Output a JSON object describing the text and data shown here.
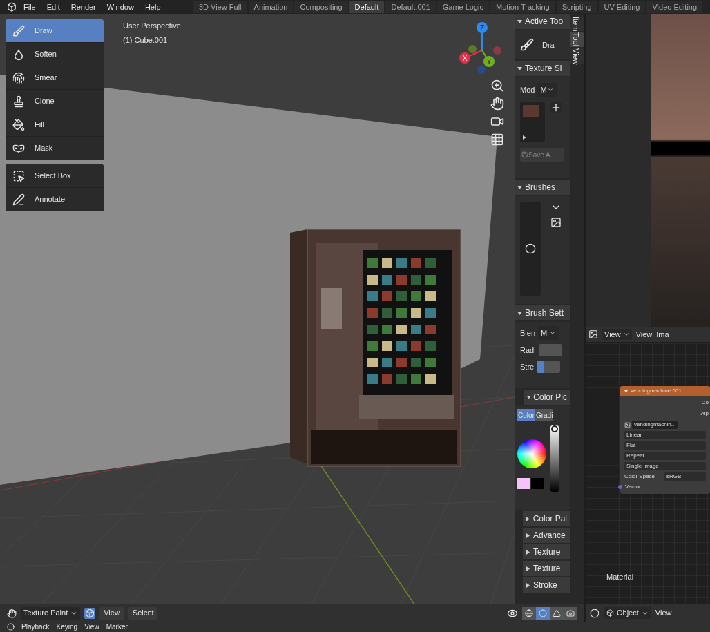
{
  "menu": [
    "File",
    "Edit",
    "Render",
    "Window",
    "Help"
  ],
  "workspaces": [
    {
      "label": "3D View Full",
      "selected": false
    },
    {
      "label": "Animation",
      "selected": false
    },
    {
      "label": "Compositing",
      "selected": false
    },
    {
      "label": "Default",
      "selected": true
    },
    {
      "label": "Default.001",
      "selected": false
    },
    {
      "label": "Game Logic",
      "selected": false
    },
    {
      "label": "Motion Tracking",
      "selected": false
    },
    {
      "label": "Scripting",
      "selected": false
    },
    {
      "label": "UV Editing",
      "selected": false
    },
    {
      "label": "Video Editing",
      "selected": false
    }
  ],
  "viewport": {
    "title": "User Perspective",
    "object": "(1) Cube.001",
    "axes": [
      "Z",
      "X",
      "Y"
    ]
  },
  "tool_groups": [
    [
      {
        "label": "Draw",
        "selected": true
      },
      {
        "label": "Soften",
        "selected": false
      },
      {
        "label": "Smear",
        "selected": false
      },
      {
        "label": "Clone",
        "selected": false
      },
      {
        "label": "Fill",
        "selected": false
      },
      {
        "label": "Mask",
        "selected": false
      }
    ],
    [
      {
        "label": "Select Box",
        "selected": false
      },
      {
        "label": "Annotate",
        "selected": false
      }
    ]
  ],
  "sidebar": {
    "tabs": [
      {
        "label": "Item",
        "selected": false
      },
      {
        "label": "Tool",
        "selected": true
      },
      {
        "label": "View",
        "selected": false
      }
    ],
    "active_tool": {
      "heading": "Active Too",
      "expanded": true,
      "tool": "Dra"
    },
    "texture_slots": {
      "heading": "Texture Sl",
      "expanded": true,
      "mode_label": "Mod",
      "mode_value": "M",
      "save_button": "Save A..."
    },
    "brushes": {
      "heading": "Brushes",
      "expanded": true
    },
    "brush_settings": {
      "heading": "Brush Sett",
      "expanded": true,
      "blend_label": "Blen",
      "blend_value": "Mi",
      "radius_label": "Radi",
      "radius": {
        "level": 0
      },
      "strength_label": "Stre",
      "strength": {
        "level": 0.3
      }
    },
    "color_picker": {
      "heading": "Color Pic",
      "expanded": true,
      "tabs": [
        {
          "label": "Color",
          "selected": true
        },
        {
          "label": "Gradi",
          "selected": false
        }
      ],
      "value": {
        "level": 1
      },
      "swatches": [
        {
          "color": "#f4c4f8"
        },
        {
          "color": "#000000"
        }
      ]
    },
    "collapsed": [
      {
        "heading": "Color Pal",
        "expanded": false
      },
      {
        "heading": "Advance",
        "expanded": false
      },
      {
        "heading": "Texture",
        "expanded": false
      },
      {
        "heading": "Texture",
        "expanded": false
      },
      {
        "heading": "Stroke",
        "expanded": false
      }
    ]
  },
  "viewport_header": {
    "mode": "Texture Paint",
    "menus": [
      "View",
      "Select"
    ],
    "shading": [
      {
        "selected": false
      },
      {
        "selected": true
      },
      {
        "selected": false
      },
      {
        "selected": false
      }
    ]
  },
  "image_editor": {
    "view_dropdown": "View",
    "menus": [
      "View",
      "Ima"
    ]
  },
  "node": {
    "title": "vendingmachine.001",
    "outputs": [
      "Co",
      "Alp"
    ],
    "image": "vendingmachin...",
    "options": [
      "Linear",
      "Flat",
      "Repeat",
      "Single Image"
    ],
    "color_space_label": "Color Space",
    "color_space": "sRGB",
    "input": "Vector"
  },
  "node_editor": {
    "label": "Material",
    "mode": "Object",
    "menus": [
      "View"
    ]
  },
  "timeline": {
    "menus": [
      "Playback",
      "Keying",
      "View",
      "Marker"
    ]
  }
}
